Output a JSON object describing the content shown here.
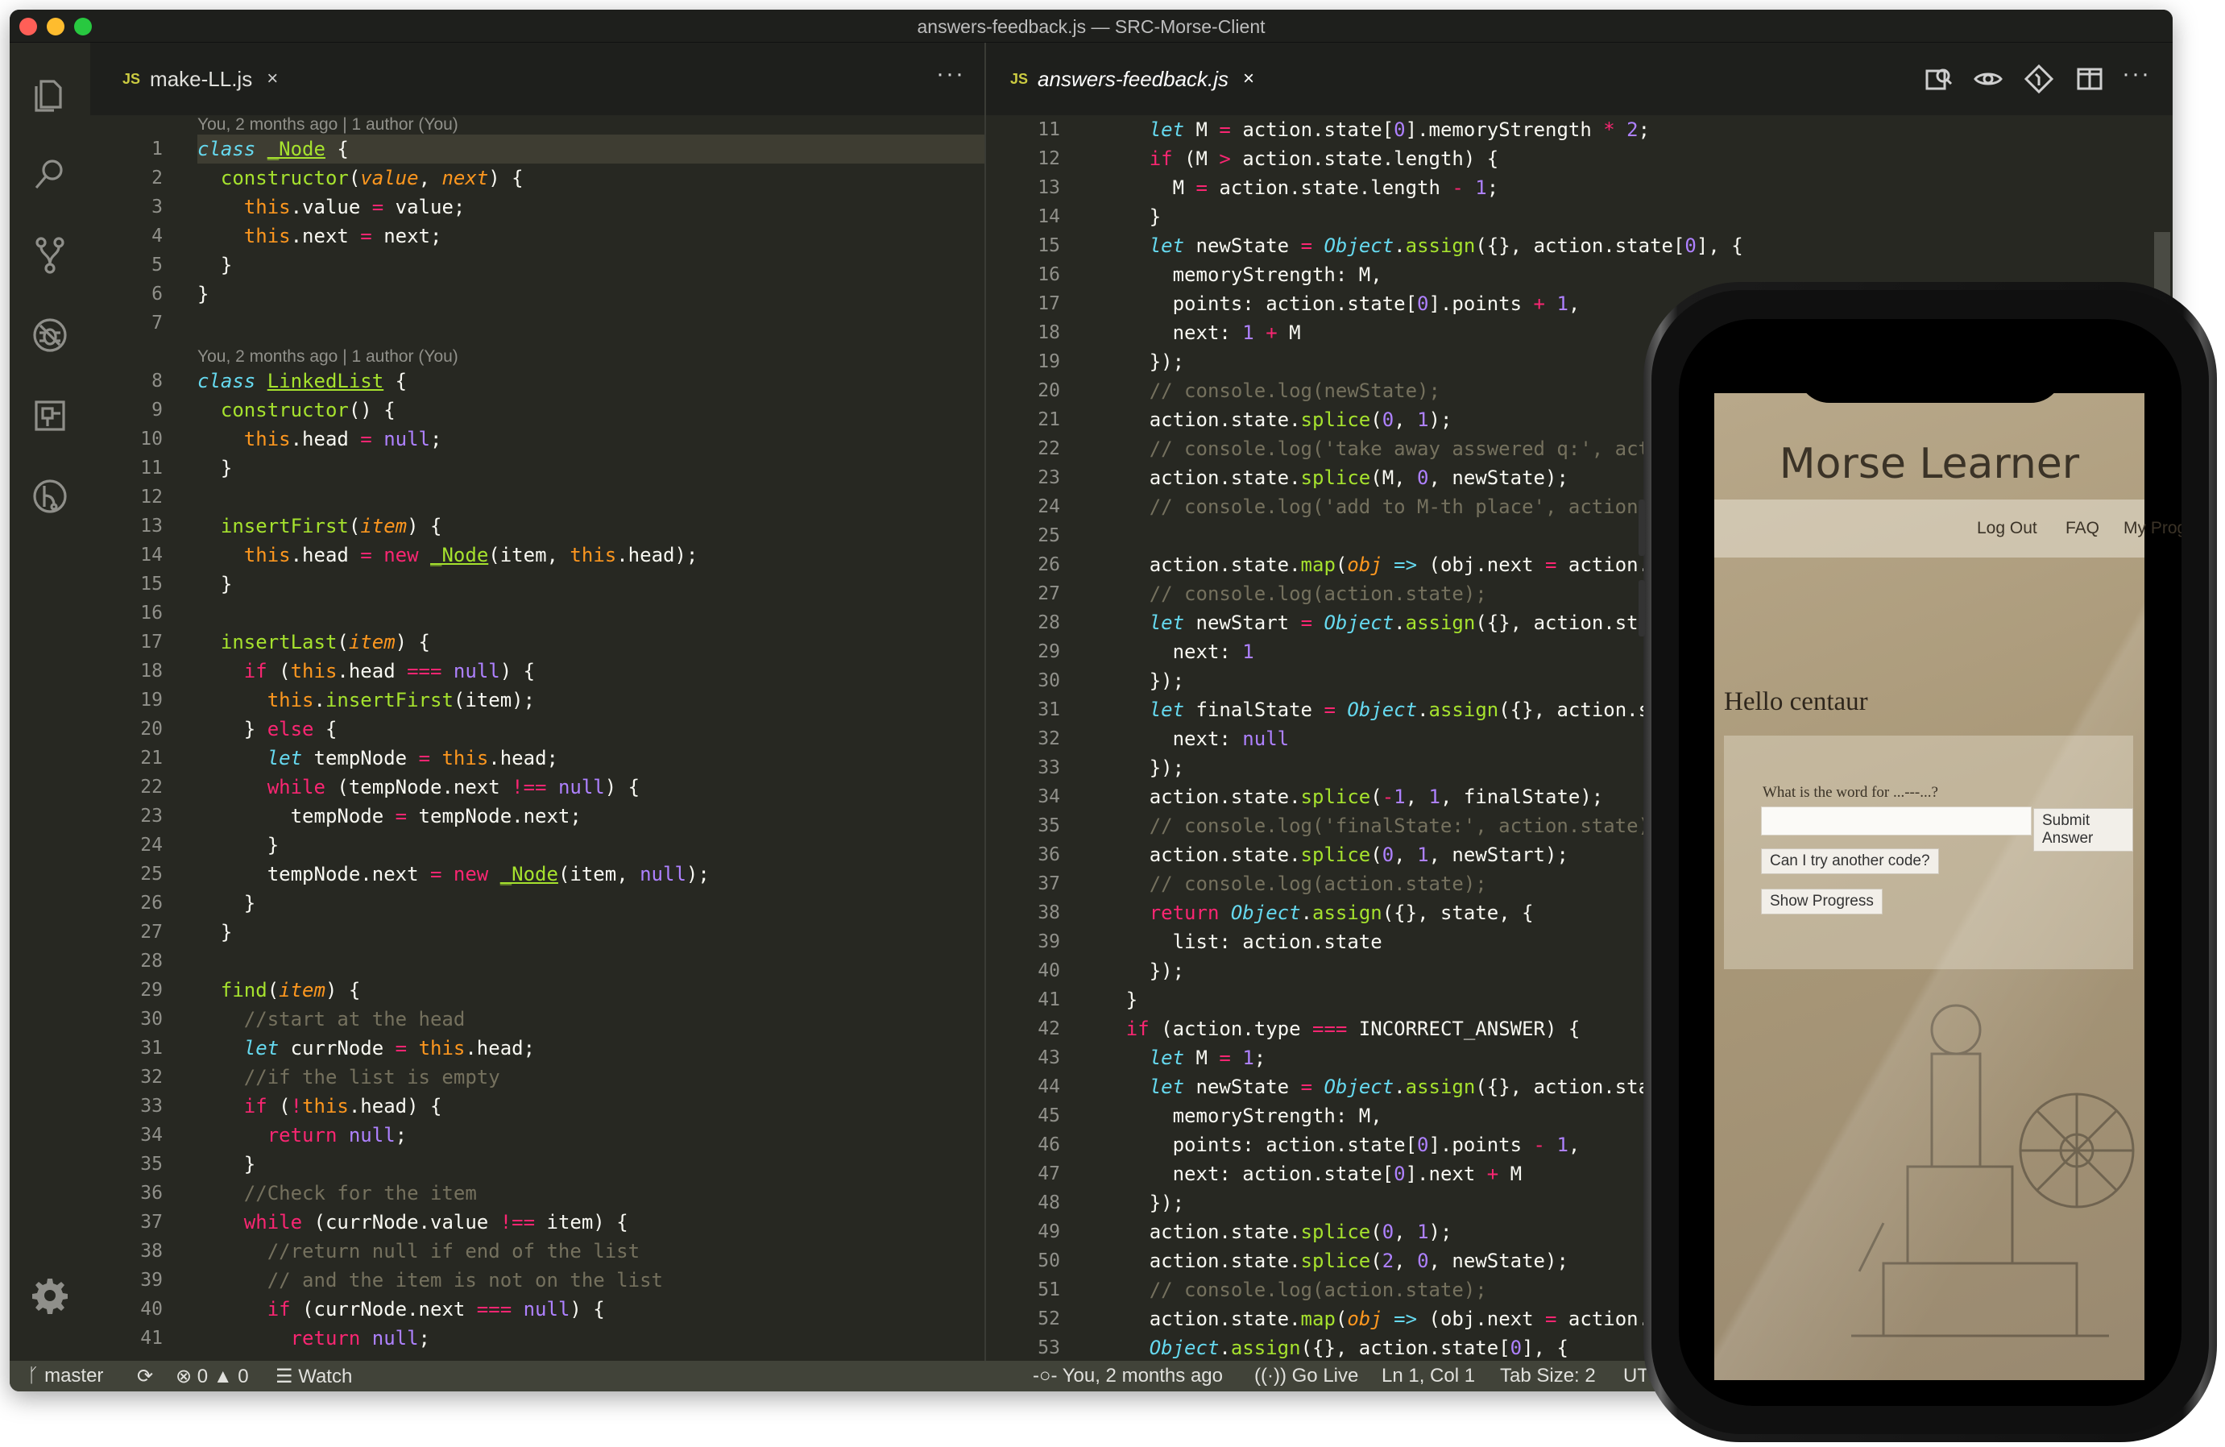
{
  "window": {
    "title": "answers-feedback.js — SRC-Morse-Client"
  },
  "activity_bar": [
    {
      "name": "explorer-icon"
    },
    {
      "name": "search-icon"
    },
    {
      "name": "source-control-icon"
    },
    {
      "name": "debug-icon"
    },
    {
      "name": "extensions-icon"
    },
    {
      "name": "gitlens-icon"
    }
  ],
  "settings_icon": "gear-icon",
  "left_editor": {
    "tab": {
      "badge": "JS",
      "label": "make-LL.js",
      "close": "×"
    },
    "more": "···",
    "blame1": "You, 2 months ago | 1 author (You)",
    "blame2": "You, 2 months ago | 1 author (You)"
  },
  "right_editor": {
    "tab": {
      "badge": "JS",
      "label": "answers-feedback.js",
      "close": "×"
    },
    "actions": [
      "open-changes-icon",
      "blame-icon",
      "git-compare-icon",
      "split-editor-icon",
      "more-actions-icon"
    ],
    "more": "···"
  },
  "status_bar": {
    "branch": "master",
    "errors": "0",
    "warnings": "0",
    "watch": "Watch",
    "blame": "You, 2 months ago",
    "golive": "Go Live",
    "position": "Ln 1, Col 1",
    "tabsize": "Tab Size: 2",
    "encoding": "UT"
  },
  "phone_app": {
    "title": "Morse Learner",
    "nav": [
      "Log Out",
      "FAQ",
      "My Progress"
    ],
    "greeting": "Hello centaur",
    "question": "What is the word for ...---...?",
    "input_value": "",
    "submit": "Submit Answer",
    "try_another": "Can I try another code?",
    "show_progress": "Show Progress"
  }
}
